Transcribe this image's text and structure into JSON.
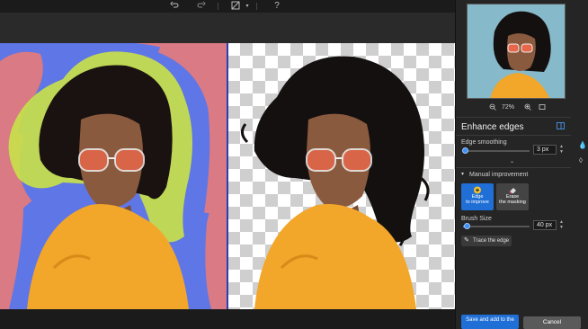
{
  "toolbar": {
    "undo_icon": "undo-icon",
    "redo_icon": "redo-icon",
    "compare_icon": "compare-icon",
    "compare_dropdown_icon": "chevron-down-icon",
    "help_label": "?"
  },
  "navigator": {
    "zoom_out_icon": "zoom-out-icon",
    "zoom_level": "72%",
    "zoom_in_icon": "zoom-in-icon",
    "fit_icon": "fit-screen-icon"
  },
  "enhance_edges": {
    "title": "Enhance edges",
    "title_icon": "panel-icon",
    "edge_smoothing_label": "Edge smoothing",
    "edge_smoothing_value": "3 px",
    "edge_smoothing_fraction": 0.03,
    "expand_icon": "chevron-down-icon"
  },
  "manual_improvement": {
    "title": "Manual improvement",
    "edge_to_improve_label": [
      "Edge",
      "to improve"
    ],
    "erase_label": [
      "Erase",
      "the masking"
    ],
    "brush_size_label": "Brush Size",
    "brush_size_value": "40 px",
    "brush_size_fraction": 0.05,
    "trace_edge_label": "Trace the edge"
  },
  "actions": {
    "save_label": "Save and add to the",
    "cancel_label": "Cancel"
  },
  "colors": {
    "accent": "#1f6fd6",
    "primary_tool": "#1f6fd6",
    "mask_overlay": "#c8e04a",
    "bg_blue": "#5f76e6",
    "bg_pink": "#d97a84",
    "shirt": "#f2a62a"
  }
}
